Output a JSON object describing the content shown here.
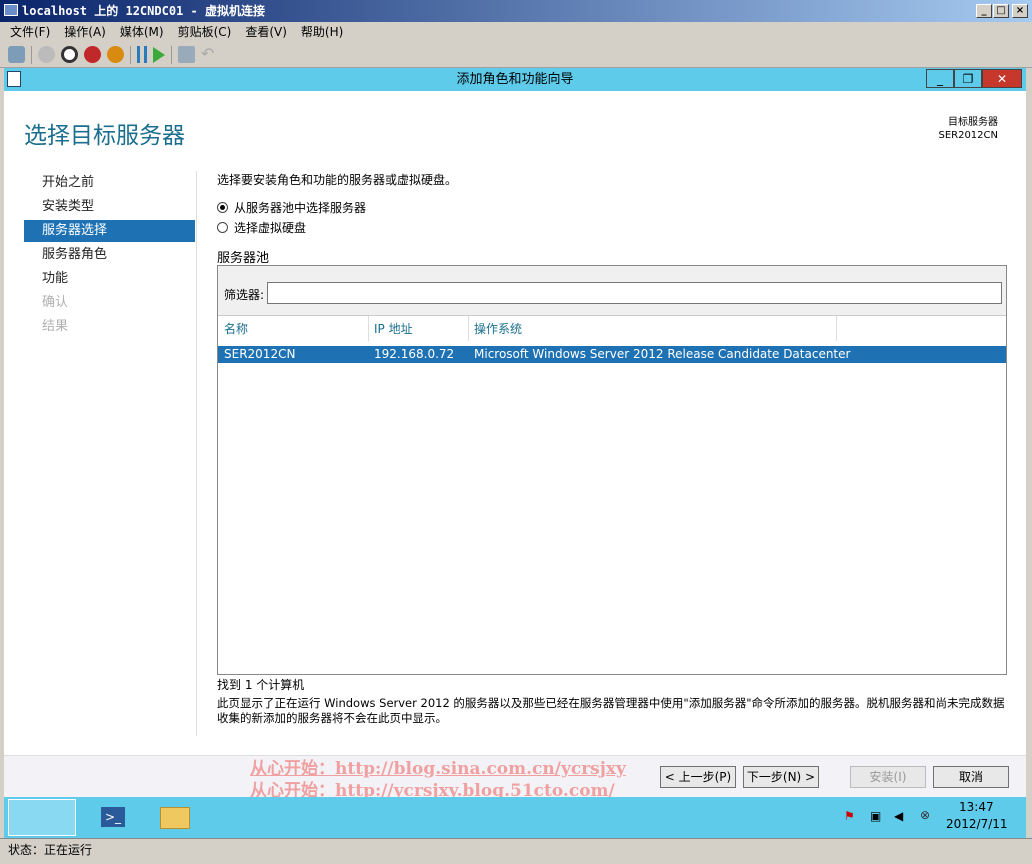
{
  "window": {
    "title": "localhost 上的 12CNDC01 - 虚拟机连接",
    "min": "_",
    "max": "□",
    "close": "×"
  },
  "menu": [
    "文件(F)",
    "操作(A)",
    "媒体(M)",
    "剪贴板(C)",
    "查看(V)",
    "帮助(H)"
  ],
  "wizard": {
    "title": "添加角色和功能向导",
    "page_title": "选择目标服务器",
    "target_label": "目标服务器",
    "target_value": "SER2012CN",
    "nav": [
      {
        "label": "开始之前",
        "state": "normal"
      },
      {
        "label": "安装类型",
        "state": "normal"
      },
      {
        "label": "服务器选择",
        "state": "selected"
      },
      {
        "label": "服务器角色",
        "state": "normal"
      },
      {
        "label": "功能",
        "state": "normal"
      },
      {
        "label": "确认",
        "state": "disabled"
      },
      {
        "label": "结果",
        "state": "disabled"
      }
    ],
    "intro": "选择要安装角色和功能的服务器或虚拟硬盘。",
    "radio1": "从服务器池中选择服务器",
    "radio2": "选择虚拟硬盘",
    "pool_label": "服务器池",
    "filter_label": "筛选器:",
    "filter_value": "",
    "columns": [
      "名称",
      "IP 地址",
      "操作系统"
    ],
    "rows": [
      {
        "name": "SER2012CN",
        "ip": "192.168.0.72",
        "os": "Microsoft Windows Server 2012 Release Candidate Datacenter"
      }
    ],
    "found": "找到 1 个计算机",
    "note": "此页显示了正在运行 Windows Server 2012 的服务器以及那些已经在服务器管理器中使用\"添加服务器\"命令所添加的服务器。脱机服务器和尚未完成数据收集的新添加的服务器将不会在此页中显示。",
    "buttons": {
      "prev": "< 上一步(P)",
      "next": "下一步(N) >",
      "install": "安装(I)",
      "cancel": "取消"
    }
  },
  "watermark": [
    "从心开始：http://blog.sina.com.cn/ycrsjxy",
    "从心开始：http://ycrsjxy.blog.51cto.com/"
  ],
  "taskbar": {
    "time": "13:47",
    "date": "2012/7/11"
  },
  "status": "状态：正在运行"
}
